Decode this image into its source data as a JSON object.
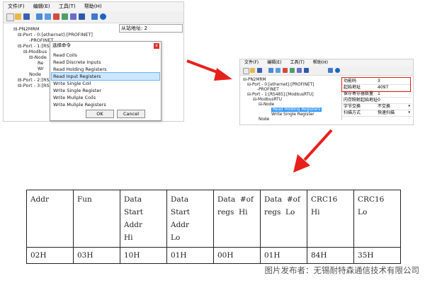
{
  "left_window": {
    "menu": [
      "文件(F)",
      "编辑(E)",
      "工具(T)",
      "帮助(H)"
    ],
    "slave_field": "从站地址: 2",
    "tree": [
      "⊟-PN2MRM",
      "⊟-Port - 0:[ethernet]:[PROFINET]",
      "-PROFINET",
      "⊟-Port - 1:[RS4",
      "⊟-Modbus",
      "⊟-Node",
      "Re",
      "Wr",
      "Node",
      "⊟-Port - 2:[RS4",
      "⊟-Port - 3:[RS4"
    ]
  },
  "dialog": {
    "title": "选择命令",
    "close": "x",
    "options": [
      "Read Coils",
      "Read Discrete Inputs",
      "Read Holding Registers",
      "Read Input Registers",
      "Write Single Coil",
      "Write Single Register",
      "Write Muliple Coils",
      "Write Muliple Registers"
    ],
    "selected_index": 3,
    "ok": "OK",
    "cancel": "Cancel"
  },
  "right_window": {
    "menu": [
      "文件(F)",
      "编辑(E)",
      "工具(T)",
      "帮助(H)"
    ],
    "tree": [
      "⊟-PN2MRM",
      "⊟-Port - 0:[ethernet]:[PROFINET]",
      "-PROFINET",
      "⊟-Port - 1:[RS485]:[ModbusRTU]",
      "⊟-ModbusRTU",
      "⊟-Node",
      "Read Holding Registers",
      "Write Single Register",
      "Node"
    ],
    "highlighted_index": 6,
    "properties": [
      {
        "label": "功能码",
        "value": "3"
      },
      {
        "label": "起始地址",
        "value": "4097"
      },
      {
        "label": "保存寄存器数量",
        "value": "1"
      },
      {
        "label": "内存映射起始地址",
        "value": "0"
      },
      {
        "label": "字节交换",
        "value": "不交换"
      },
      {
        "label": "扫描方式",
        "value": "快速扫描"
      }
    ],
    "highlight_color": "#e02020"
  },
  "arrows": {
    "color": "#e8201c"
  },
  "table": {
    "headers": [
      [
        "Addr"
      ],
      [
        "Fun"
      ],
      [
        "Data",
        "Start",
        "Addr",
        "Hi"
      ],
      [
        "Data",
        "Start",
        "Addr",
        "Lo"
      ],
      [
        "Data  #of",
        "regs  Hi"
      ],
      [
        "Data  #of",
        "regs  Lo"
      ],
      [
        "CRC16",
        "Hi"
      ],
      [
        "CRC16",
        "Lo"
      ]
    ],
    "values": [
      "02H",
      "03H",
      "10H",
      "01H",
      "00H",
      "01H",
      "84H",
      "35H"
    ]
  },
  "watermark": "图片发布者：无锡耐特森通信技术有限公司"
}
